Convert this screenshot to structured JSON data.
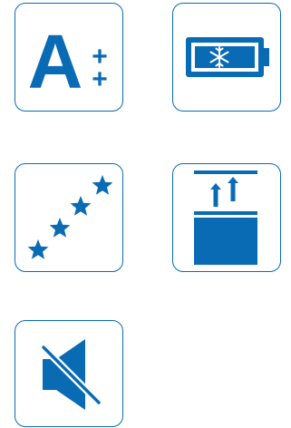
{
  "colors": {
    "accent": "#0a6bb5",
    "background": "#ffffff"
  },
  "tiles": [
    {
      "icon": "energy-class-a-plus-plus-icon",
      "letter": "A",
      "superscript": [
        "+",
        "+"
      ]
    },
    {
      "icon": "battery-freeze-icon"
    },
    {
      "icon": "rising-stars-icon",
      "stars": 4
    },
    {
      "icon": "raise-height-icon"
    },
    {
      "icon": "sound-muted-icon"
    }
  ]
}
